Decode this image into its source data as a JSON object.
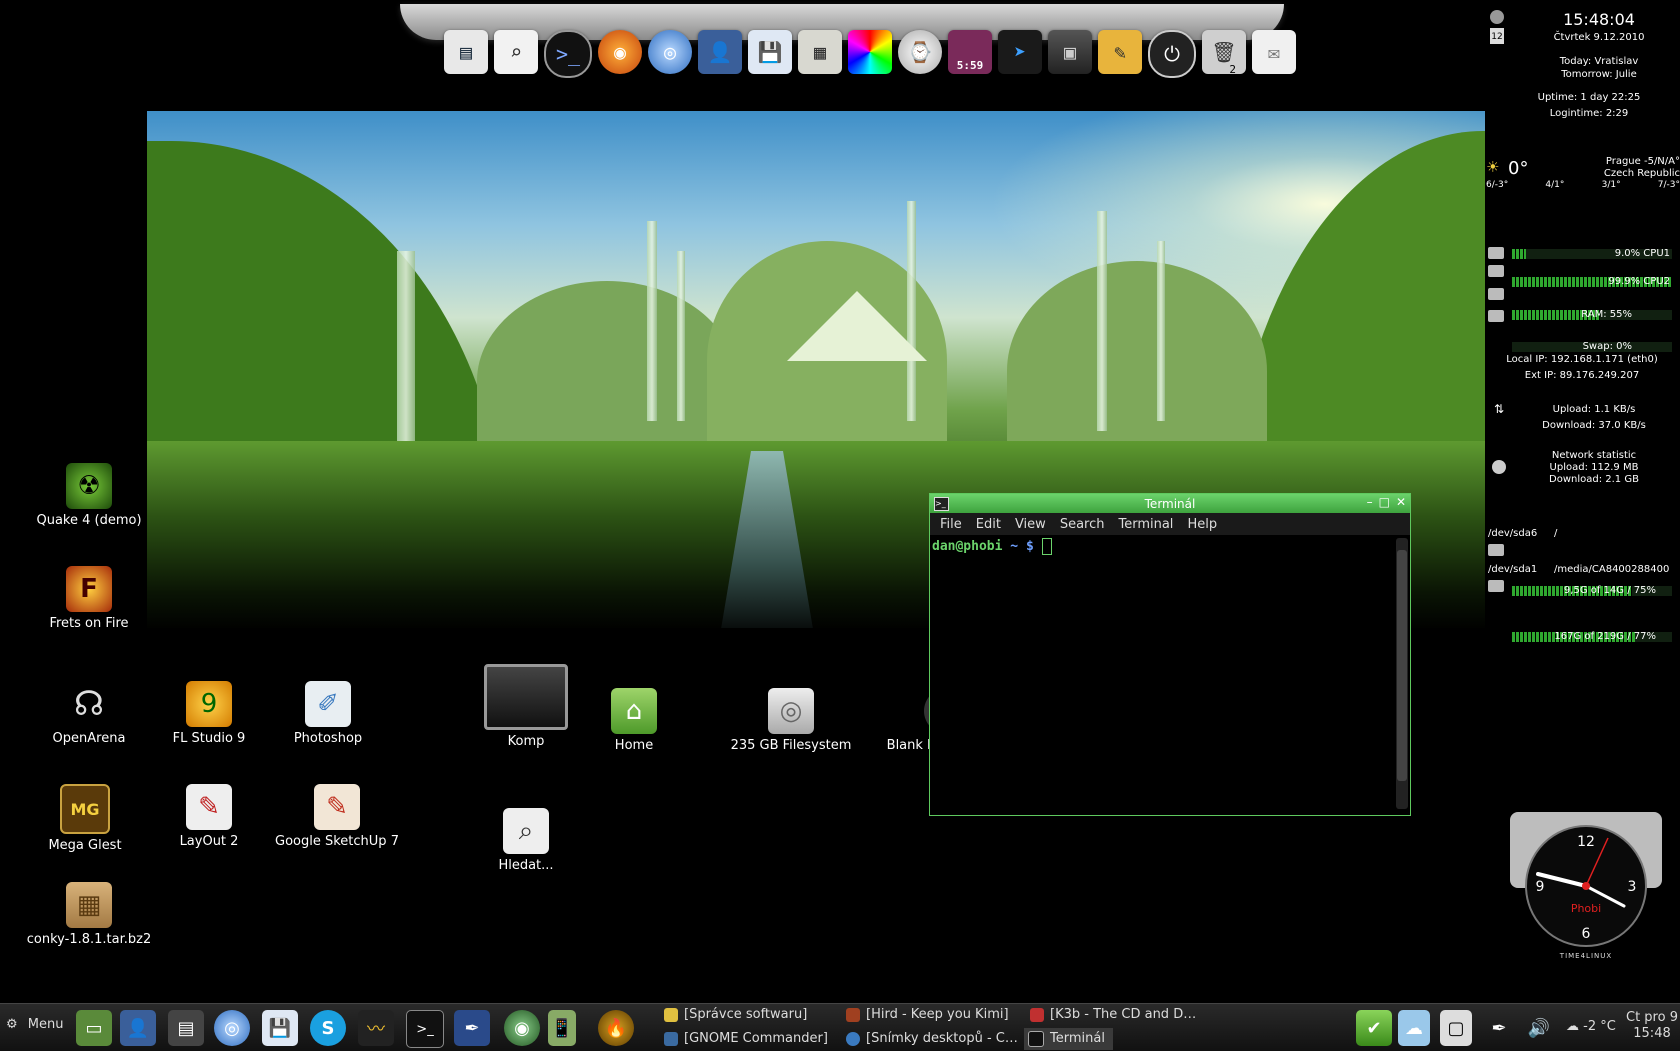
{
  "dock": {
    "icons": [
      "window-list-icon",
      "search-icon",
      "terminal-icon",
      "firefox-icon",
      "browser-icon",
      "user-icon",
      "floppy-icon",
      "calculator-icon",
      "color-picker-icon",
      "clock-app-icon",
      "calendar-icon",
      "pointer-icon",
      "box-icon",
      "notes-icon",
      "power-icon",
      "trash-icon",
      "mail-icon"
    ],
    "calendar_time": "5:59",
    "trash_count": "2"
  },
  "terminal": {
    "title": "Terminál",
    "menu": [
      "File",
      "Edit",
      "View",
      "Search",
      "Terminal",
      "Help"
    ],
    "prompt_user": "dan@phobi",
    "prompt_path": "~",
    "prompt_sign": "$"
  },
  "desktop": {
    "icons": [
      {
        "id": "quake",
        "label": "Quake 4 (demo)"
      },
      {
        "id": "frets",
        "label": "Frets on Fire"
      },
      {
        "id": "openarena",
        "label": "OpenArena"
      },
      {
        "id": "flstudio",
        "label": "FL Studio 9"
      },
      {
        "id": "photoshop",
        "label": "Photoshop"
      },
      {
        "id": "megaglest",
        "label": "Mega Glest"
      },
      {
        "id": "layout",
        "label": "LayOut 2"
      },
      {
        "id": "sketchup",
        "label": "Google SketchUp 7"
      },
      {
        "id": "conky",
        "label": "conky-1.8.1.tar.bz2"
      },
      {
        "id": "komp",
        "label": "Komp"
      },
      {
        "id": "home",
        "label": "Home"
      },
      {
        "id": "fs",
        "label": "235 GB Filesystem"
      },
      {
        "id": "dvd",
        "label": "Blank DVD+R Disc"
      },
      {
        "id": "hledat",
        "label": "Hledat..."
      }
    ]
  },
  "conky": {
    "time": "15:48:04",
    "date": "Čtvrtek 9.12.2010",
    "cal_day": "12",
    "today": "Today: Vratislav",
    "tomorrow": "Tomorrow: Julie",
    "uptime": "Uptime: 1 day 22:25",
    "logintime": "Logintime: 2:29",
    "weather_temp": "0°",
    "weather_loc": "Prague -5/N/A°",
    "weather_country": "Czech Republic",
    "forecast": [
      "6/-3°",
      "4/1°",
      "3/1°",
      "7/-3°"
    ],
    "cpu1": "9.0% CPU1",
    "cpu2": "99.9% CPU2",
    "ram": "RAM: 55%",
    "swap": "Swap: 0%",
    "cpu1_pct": 9,
    "cpu2_pct": 99.9,
    "ram_pct": 55,
    "swap_pct": 0,
    "local_ip": "Local IP: 192.168.1.171 (eth0)",
    "ext_ip": "Ext IP: 89.176.249.207",
    "upload": "Upload: 1.1 KB/s",
    "download": "Download: 37.0 KB/s",
    "net_title": "Network statistic",
    "net_up": "Upload: 112.9 MB",
    "net_down": "Download: 2.1 GB",
    "disk1_dev": "/dev/sda6",
    "disk1_mount": "/",
    "disk1_usage": "9,5G of 14G / 75%",
    "disk1_pct": 75,
    "disk2_dev": "/dev/sda1",
    "disk2_mount": "/media/CA8400288400",
    "disk2_usage": "167G of 219G / 77%",
    "disk2_pct": 77
  },
  "clock": {
    "brand": "Phobi",
    "maker": "TIME4LINUX",
    "numerals": [
      "12",
      "3",
      "6",
      "9"
    ]
  },
  "taskbar": {
    "menu_label": "Menu",
    "tasks": [
      "[Správce softwaru]",
      "[Hird - Keep you Kimi]",
      "[K3b - The CD and D…",
      "[GNOME Commander]",
      "[Snímky desktopů - C…",
      "Terminál"
    ],
    "temp": "-2 °C",
    "date": "Čt pro 9",
    "time": "15:48"
  }
}
